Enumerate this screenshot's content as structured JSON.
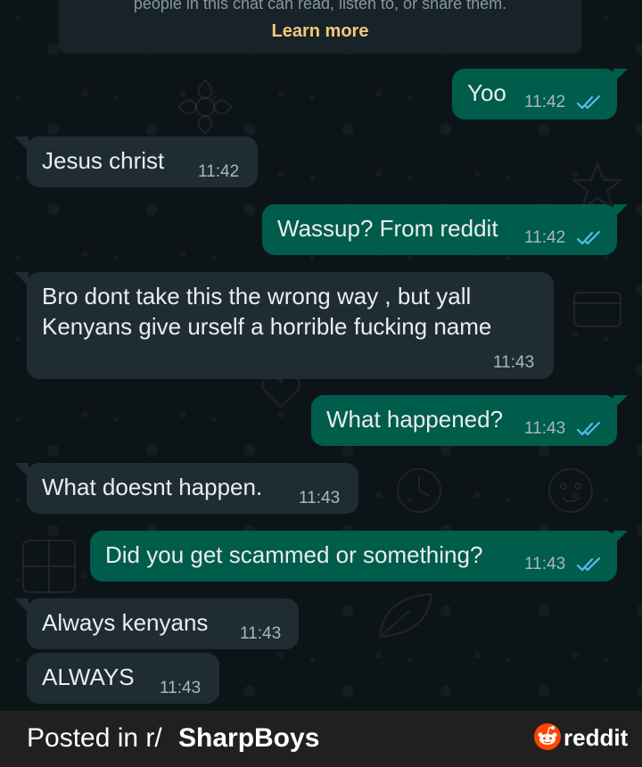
{
  "notice": {
    "text": "people in this chat can read, listen to, or share them.",
    "link": "Learn more"
  },
  "messages": [
    {
      "dir": "out",
      "text": "Yoo",
      "time": "11:42",
      "status": "read"
    },
    {
      "dir": "in",
      "text": "Jesus christ",
      "time": "11:42"
    },
    {
      "dir": "out",
      "text": "Wassup? From reddit",
      "time": "11:42",
      "status": "read"
    },
    {
      "dir": "in",
      "line1": "Bro dont take this the wrong way , but yall",
      "line2": "Kenyans give urself a horrible fucking name",
      "time": "11:43"
    },
    {
      "dir": "out",
      "text": "What happened?",
      "time": "11:43",
      "status": "read"
    },
    {
      "dir": "in",
      "text": "What doesnt happen.",
      "time": "11:43"
    },
    {
      "dir": "out",
      "text": "Did you get scammed or something?",
      "time": "11:43",
      "status": "read"
    },
    {
      "dir": "in",
      "text": "Always kenyans",
      "time": "11:43"
    },
    {
      "dir": "in",
      "text": "ALWAYS",
      "time": "11:43"
    }
  ],
  "footer": {
    "prefix": "Posted in r/",
    "subreddit": "SharpBoys",
    "brand": "reddit"
  },
  "colors": {
    "outgoing_bubble": "#005c4b",
    "incoming_bubble": "#202c33",
    "read_tick": "#53bdeb",
    "learn_more": "#f3c87a",
    "reddit_orange": "#ff4500"
  }
}
